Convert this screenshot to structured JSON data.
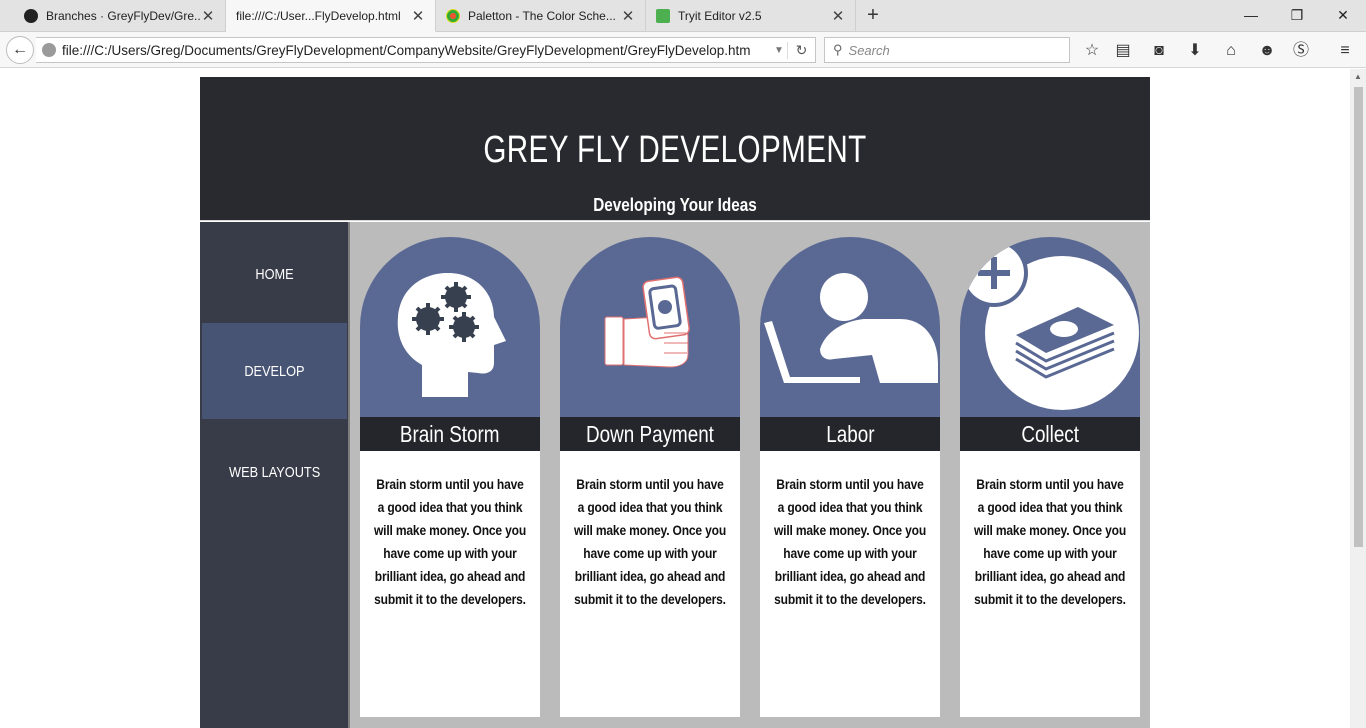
{
  "browser": {
    "tabs": [
      {
        "label": "Branches · GreyFlyDev/Gre..."
      },
      {
        "label": "file:///C:/User...FlyDevelop.html"
      },
      {
        "label": "Paletton - The Color Sche..."
      },
      {
        "label": "Tryit Editor v2.5"
      }
    ],
    "url": "file:///C:/Users/Greg/Documents/GreyFlyDevelopment/CompanyWebsite/GreyFlyDevelopment/GreyFlyDevelop.htm",
    "search_placeholder": "Search"
  },
  "site": {
    "title": "GREY FLY DEVELOPMENT",
    "subtitle": "Developing Your Ideas",
    "nav": [
      {
        "label": "HOME"
      },
      {
        "label": "DEVELOP"
      },
      {
        "label": "WEB LAYOUTS"
      }
    ],
    "cards": [
      {
        "title": "Brain Storm",
        "icon": "brainstorm-head-icon",
        "text": "Brain storm until you have a good idea that you think will make money. Once you have come up with your brilliant idea, go ahead and submit it to the developers."
      },
      {
        "title": "Down Payment",
        "icon": "cash-hand-icon",
        "text": "Brain storm until you have a good idea that you think will make money. Once you have come up with your brilliant idea, go ahead and submit it to the developers."
      },
      {
        "title": "Labor",
        "icon": "laptop-worker-icon",
        "text": "Brain storm until you have a good idea that you think will make money. Once you have come up with your brilliant idea, go ahead and submit it to the developers."
      },
      {
        "title": "Collect",
        "icon": "money-stack-icon",
        "text": "Brain storm until you have a good idea that you think will make money. Once you have come up with your brilliant idea, go ahead and submit it to the developers."
      }
    ]
  },
  "colors": {
    "header_bg": "#292a2f",
    "sidebar_bg": "#383c49",
    "active_nav": "#485474",
    "card_arch": "#5a6894",
    "card_label": "#25262b",
    "content_bg": "#bbbbbb"
  }
}
